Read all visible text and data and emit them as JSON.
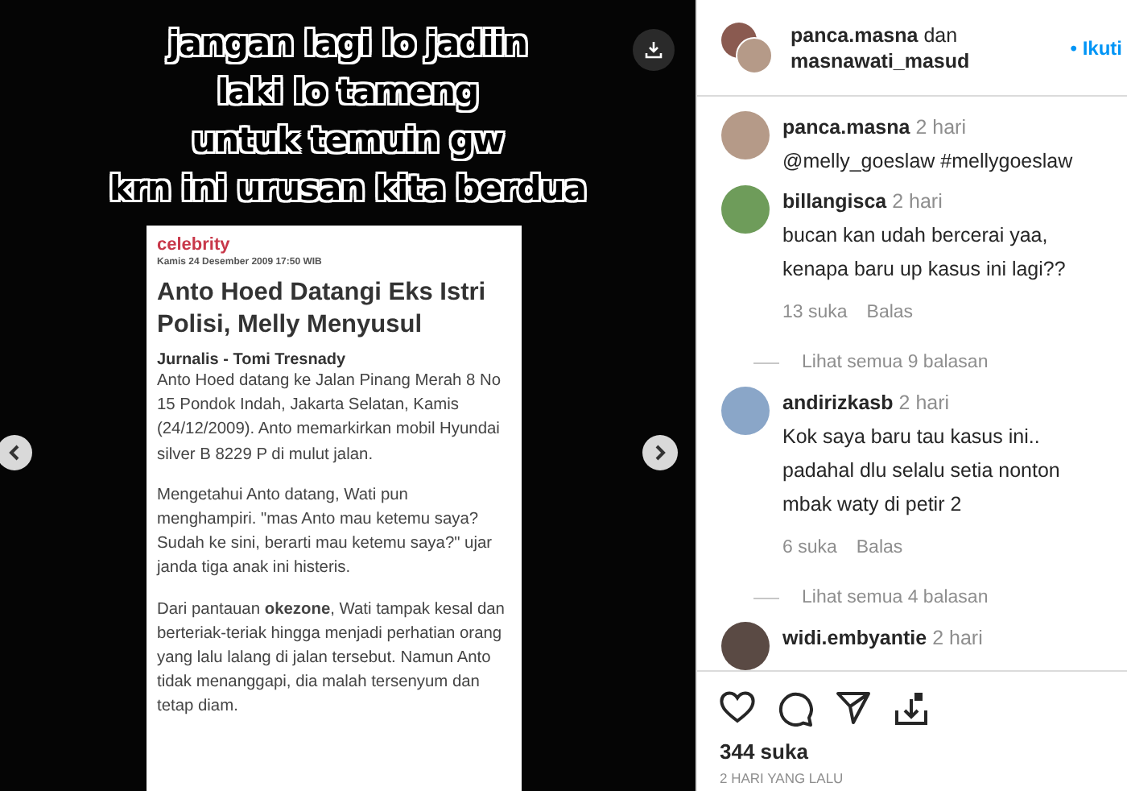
{
  "media": {
    "caption_lines": [
      "jangan lagi lo jadiin",
      "laki lo tameng",
      "untuk temuin gw",
      "krn ini urusan kita berdua"
    ],
    "article": {
      "section": "celebrity",
      "date": "Kamis 24 Desember 2009 17:50 WIB",
      "headline": "Anto Hoed Datangi Eks Istri Polisi, Melly Menyusul",
      "author": "Jurnalis - Tomi Tresnady",
      "paragraphs": [
        "Anto Hoed datang ke Jalan Pinang Merah 8 No 15 Pondok Indah, Jakarta Selatan, Kamis (24/12/2009). Anto memarkirkan mobil Hyundai silver B 8229 P di mulut jalan.",
        "Mengetahui Anto datang, Wati pun menghampiri. \"mas Anto mau ketemu saya? Sudah ke sini, berarti mau ketemu saya?\" ujar janda tiga anak ini histeris.",
        "Dari pantauan **okezone**, Wati tampak kesal dan berteriak-teriak hingga menjadi perhatian orang yang lalu lalang di jalan tersebut. Namun Anto tidak menanggapi, dia malah tersenyum dan tetap diam."
      ]
    }
  },
  "header": {
    "author": "panca.masna",
    "joiner": "dan",
    "coauthor": "masnawati_masud",
    "follow": "• Ikuti"
  },
  "comments": [
    {
      "kind": "caption",
      "user": "panca.masna",
      "time": "2 hari",
      "text": "@melly_goeslaw #mellygoeslaw"
    },
    {
      "kind": "comment",
      "user": "billangisca",
      "time": "2 hari",
      "text": "bucan kan udah bercerai yaa, kenapa baru up kasus ini lagi??",
      "likes": "13 suka",
      "reply": "Balas",
      "replies": "Lihat semua 9 balasan"
    },
    {
      "kind": "comment",
      "user": "andirizkasb",
      "time": "2 hari",
      "text": "Kok saya baru tau kasus ini.. padahal dlu selalu setia nonton mbak waty di petir 2",
      "likes": "6 suka",
      "reply": "Balas",
      "replies": "Lihat semua 4 balasan"
    },
    {
      "kind": "comment",
      "user": "widi.embyantie",
      "time": "2 hari"
    }
  ],
  "likes": "344 suka",
  "posted": "2 HARI YANG LALU"
}
